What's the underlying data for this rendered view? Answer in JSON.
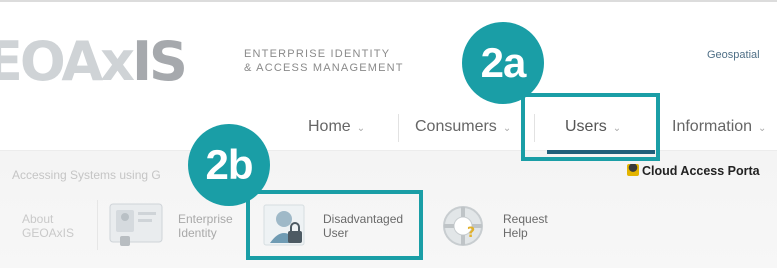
{
  "header": {
    "logo_main": "EOAx",
    "logo_accent": "IS",
    "tagline_line1": "ENTERPRISE IDENTITY",
    "tagline_line2": "& ACCESS MANAGEMENT",
    "geo_link": "Geospatial"
  },
  "nav": {
    "items": [
      {
        "label": "Home"
      },
      {
        "label": "Consumers"
      },
      {
        "label": "Users"
      },
      {
        "label": "Information"
      }
    ],
    "chevron": "⌄"
  },
  "subbar": {
    "accessing_text": "Accessing Systems using G",
    "cloud_portal": "Cloud Access Porta"
  },
  "tiles": [
    {
      "line1": "About",
      "line2": "GEOAxIS"
    },
    {
      "line1": "Enterprise",
      "line2": "Identity"
    },
    {
      "line1": "Disadvantaged",
      "line2": "User"
    },
    {
      "line1": "Request",
      "line2": "Help"
    }
  ],
  "callouts": {
    "a": "2a",
    "b": "2b"
  },
  "colors": {
    "callout": "#1a9ea6",
    "nav_active_underline": "#1f5f7a"
  }
}
